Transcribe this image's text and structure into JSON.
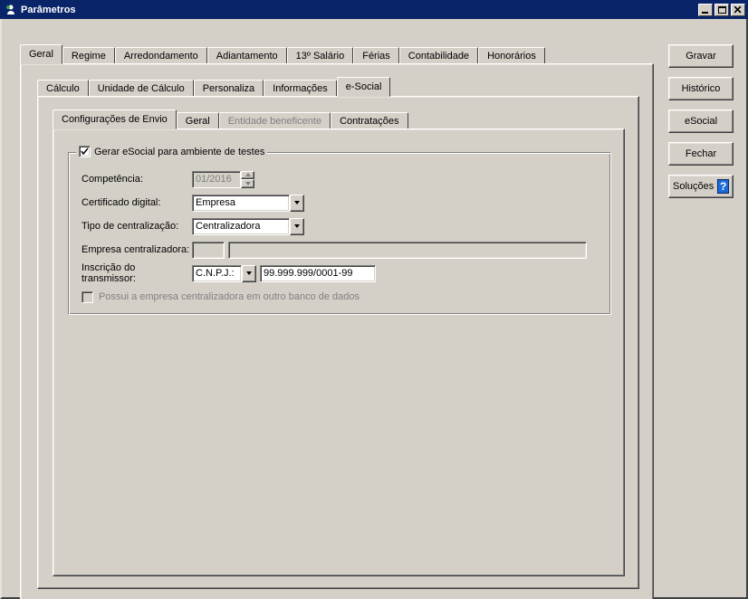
{
  "window": {
    "title": "Parâmetros"
  },
  "actions": {
    "gravar": "Gravar",
    "historico": "Histórico",
    "esocial": "eSocial",
    "fechar": "Fechar",
    "solucoes": "Soluções"
  },
  "tabs": {
    "main": [
      "Geral",
      "Regime",
      "Arredondamento",
      "Adiantamento",
      "13º Salário",
      "Férias",
      "Contabilidade",
      "Honorários"
    ],
    "sub": [
      "Cálculo",
      "Unidade de Cálculo",
      "Personaliza",
      "Informações",
      "e-Social"
    ],
    "inner": [
      "Configurações de Envio",
      "Geral",
      "Entidade beneficente",
      "Contratações"
    ]
  },
  "group": {
    "legend": "Gerar eSocial para ambiente de testes",
    "legend_checked": true,
    "fields": {
      "competencia_label": "Competência:",
      "competencia_value": "01/2016",
      "cert_label": "Certificado digital:",
      "cert_value": "Empresa",
      "tipo_label": "Tipo de centralização:",
      "tipo_value": "Centralizadora",
      "empcentral_label": "Empresa centralizadora:",
      "empcentral_code": "",
      "empcentral_name": "",
      "inscr_label": "Inscrição do transmissor:",
      "inscr_type": "C.N.P.J.:",
      "inscr_value": "99.999.999/0001-99",
      "db_check": "Possui a empresa centralizadora em outro banco de dados"
    }
  }
}
